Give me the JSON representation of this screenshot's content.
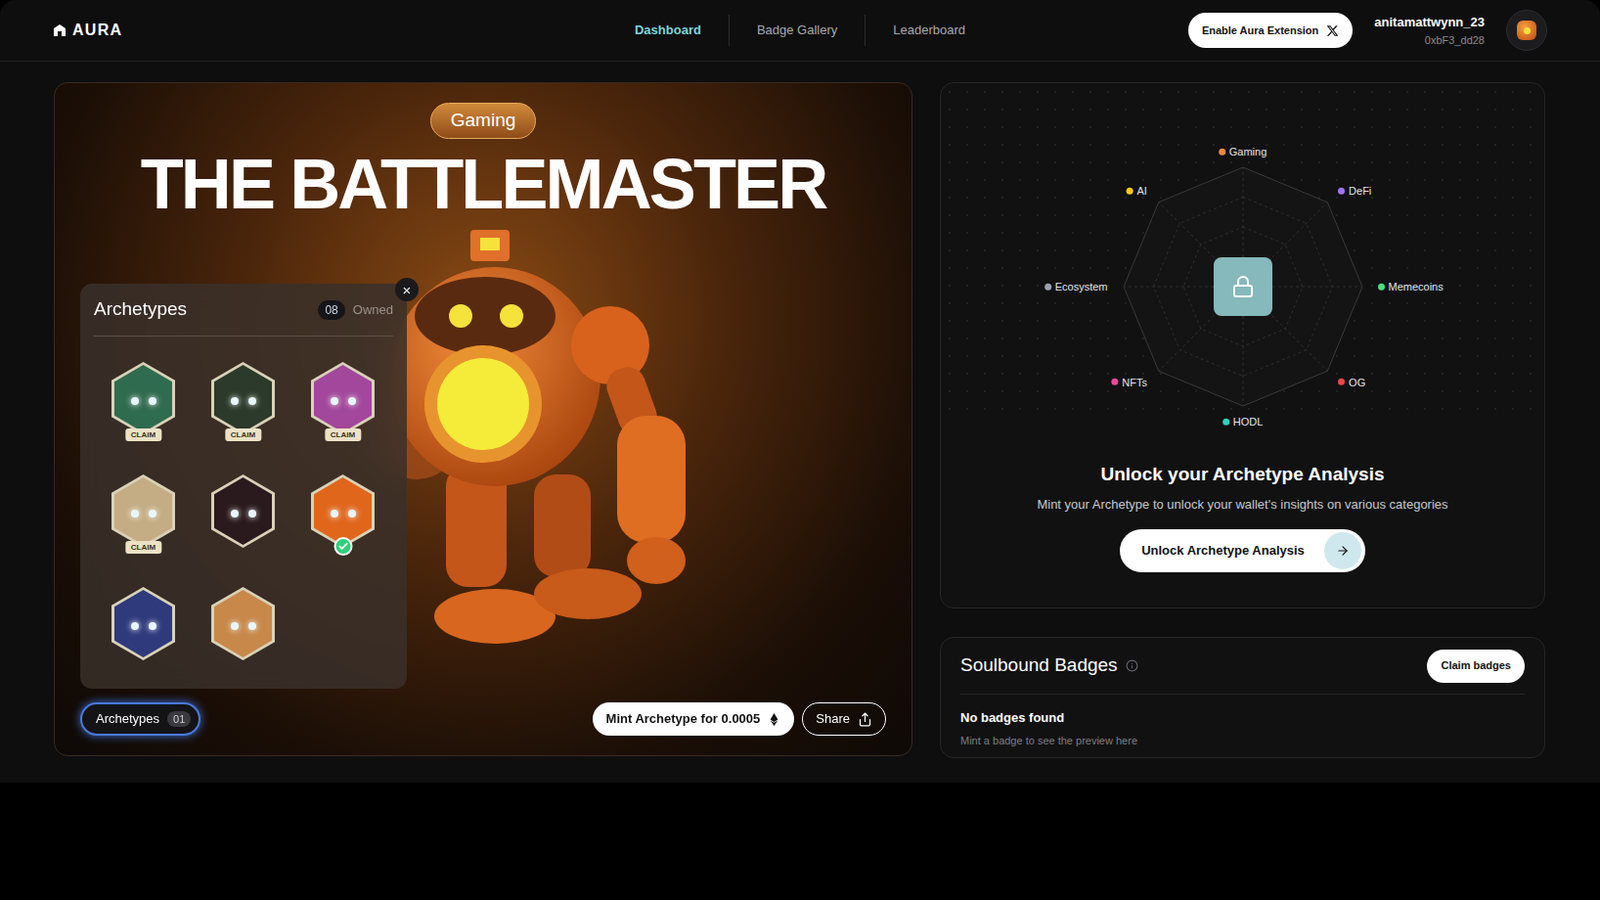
{
  "header": {
    "logo": "AURA",
    "nav": [
      {
        "label": "Dashboard",
        "selected": true
      },
      {
        "label": "Badge Gallery",
        "selected": false
      },
      {
        "label": "Leaderboard",
        "selected": false
      }
    ],
    "extension_button": "Enable Aura Extension",
    "user": {
      "name": "anitamattwynn_23",
      "address": "0xbF3_dd28"
    }
  },
  "hero": {
    "tag": "Gaming",
    "title": "THE BATTLEMASTER",
    "archetypes_button": {
      "label": "Archetypes",
      "count": "01"
    },
    "mint_button": "Mint Archetype for 0.0005",
    "share_button": "Share"
  },
  "archetypes_panel": {
    "title": "Archetypes",
    "count": "08",
    "count_label": "Owned",
    "close": "×",
    "items": [
      {
        "claim": "CLAIM",
        "selected": false,
        "color": "#2f6b4e"
      },
      {
        "claim": "CLAIM",
        "selected": false,
        "color": "#2b3a2a"
      },
      {
        "claim": "CLAIM",
        "selected": false,
        "color": "#a2479c"
      },
      {
        "claim": "CLAIM",
        "selected": false,
        "color": "#c4ad84"
      },
      {
        "selected": false,
        "color": "#2a1a1e"
      },
      {
        "selected": true,
        "color": "#e0661c"
      },
      {
        "selected": false,
        "color": "#2e3a7c"
      },
      {
        "selected": false,
        "color": "#c7884a"
      }
    ]
  },
  "analysis": {
    "locked": true,
    "axes": [
      {
        "label": "Gaming",
        "color": "#f08a3c"
      },
      {
        "label": "DeFi",
        "color": "#a371f7"
      },
      {
        "label": "Memecoins",
        "color": "#4ade80"
      },
      {
        "label": "OG",
        "color": "#ef4444"
      },
      {
        "label": "HODL",
        "color": "#2dd4bf"
      },
      {
        "label": "NFTs",
        "color": "#ec4899"
      },
      {
        "label": "Ecosystem",
        "color": "#9ca3af"
      },
      {
        "label": "AI",
        "color": "#facc15"
      }
    ],
    "title": "Unlock your Archetype Analysis",
    "subtitle": "Mint your Archetype to unlock your wallet's insights on various categories",
    "button": "Unlock Archetype Analysis"
  },
  "badges": {
    "title": "Soulbound Badges",
    "button": "Claim badges",
    "empty_title": "No badges found",
    "empty_subtitle": "Mint a badge to see the preview here"
  }
}
